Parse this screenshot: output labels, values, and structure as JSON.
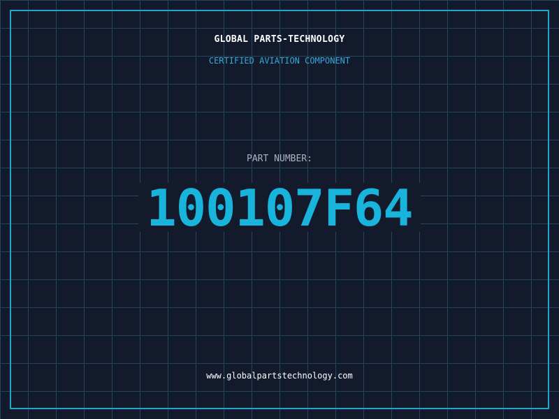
{
  "brand": {
    "name": "GLOBAL PARTS-TECHNOLOGY",
    "tagline": "CERTIFIED AVIATION COMPONENT"
  },
  "part": {
    "label": "PART NUMBER:",
    "number": "100107F64"
  },
  "footer": {
    "website": "www.globalpartstechnology.com"
  },
  "colors": {
    "background": "#121a2c",
    "grid": "#23465a",
    "frame": "#1fa6c9",
    "accent": "#18b4dc",
    "tagline": "#35a9da"
  }
}
